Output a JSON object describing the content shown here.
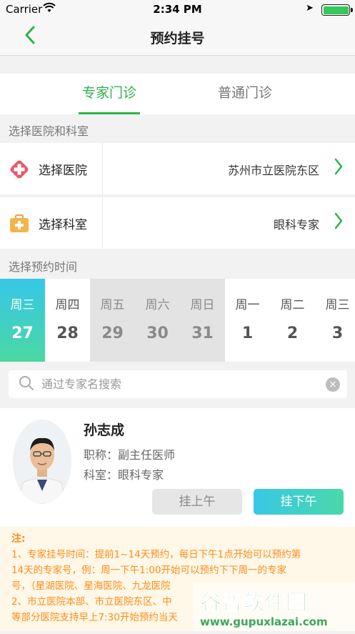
{
  "status_bar": {
    "carrier": "Carrier",
    "time": "2:34 PM"
  },
  "nav": {
    "title": "预约挂号",
    "back_icon": "chevron-left-icon"
  },
  "tabs": [
    {
      "label": "专家门诊",
      "active": true
    },
    {
      "label": "普通门诊",
      "active": false
    }
  ],
  "hospital_section": {
    "header": "选择医院和科室",
    "hospital": {
      "label": "选择医院",
      "value": "苏州市立医院东区"
    },
    "department": {
      "label": "选择科室",
      "value": "眼科专家"
    }
  },
  "time_section": {
    "header": "选择预约时间",
    "days": [
      {
        "weekday": "周三",
        "date": "27",
        "state": "selected"
      },
      {
        "weekday": "周四",
        "date": "28",
        "state": "normal"
      },
      {
        "weekday": "周五",
        "date": "29",
        "state": "disabled"
      },
      {
        "weekday": "周六",
        "date": "30",
        "state": "disabled"
      },
      {
        "weekday": "周日",
        "date": "31",
        "state": "disabled"
      },
      {
        "weekday": "周一",
        "date": "1",
        "state": "normal"
      },
      {
        "weekday": "周二",
        "date": "2",
        "state": "normal"
      },
      {
        "weekday": "周三",
        "date": "3",
        "state": "normal"
      }
    ]
  },
  "search": {
    "placeholder": "通过专家名搜索"
  },
  "doctor": {
    "name": "孙志成",
    "title": "职称：副主任医师",
    "department": "科室：眼科专家",
    "morning_button": "挂上午",
    "afternoon_button": "挂下午"
  },
  "notice": {
    "heading": "注:",
    "line1": "1、专家挂号时间：提前1~14天预约，每日下午1点开始可以预约第",
    "line2": "14天的专家号，例：周一下午1:00开始可以预约下下周一的专家",
    "line3": "号，（星湖医院、星海医院、九龙医院",
    "line4": "2、市立医院本部、市立医院东区、中",
    "line5": "等部分医院支持早上7:30开始预约当天"
  },
  "watermark": {
    "cn": "谷普软件园",
    "url": "www.gupuxlazai.com"
  },
  "colors": {
    "accent": "#2fb24a",
    "gradient_start": "#37c7e8",
    "gradient_end": "#4ad8a2",
    "notice": "#ff8c1a"
  }
}
